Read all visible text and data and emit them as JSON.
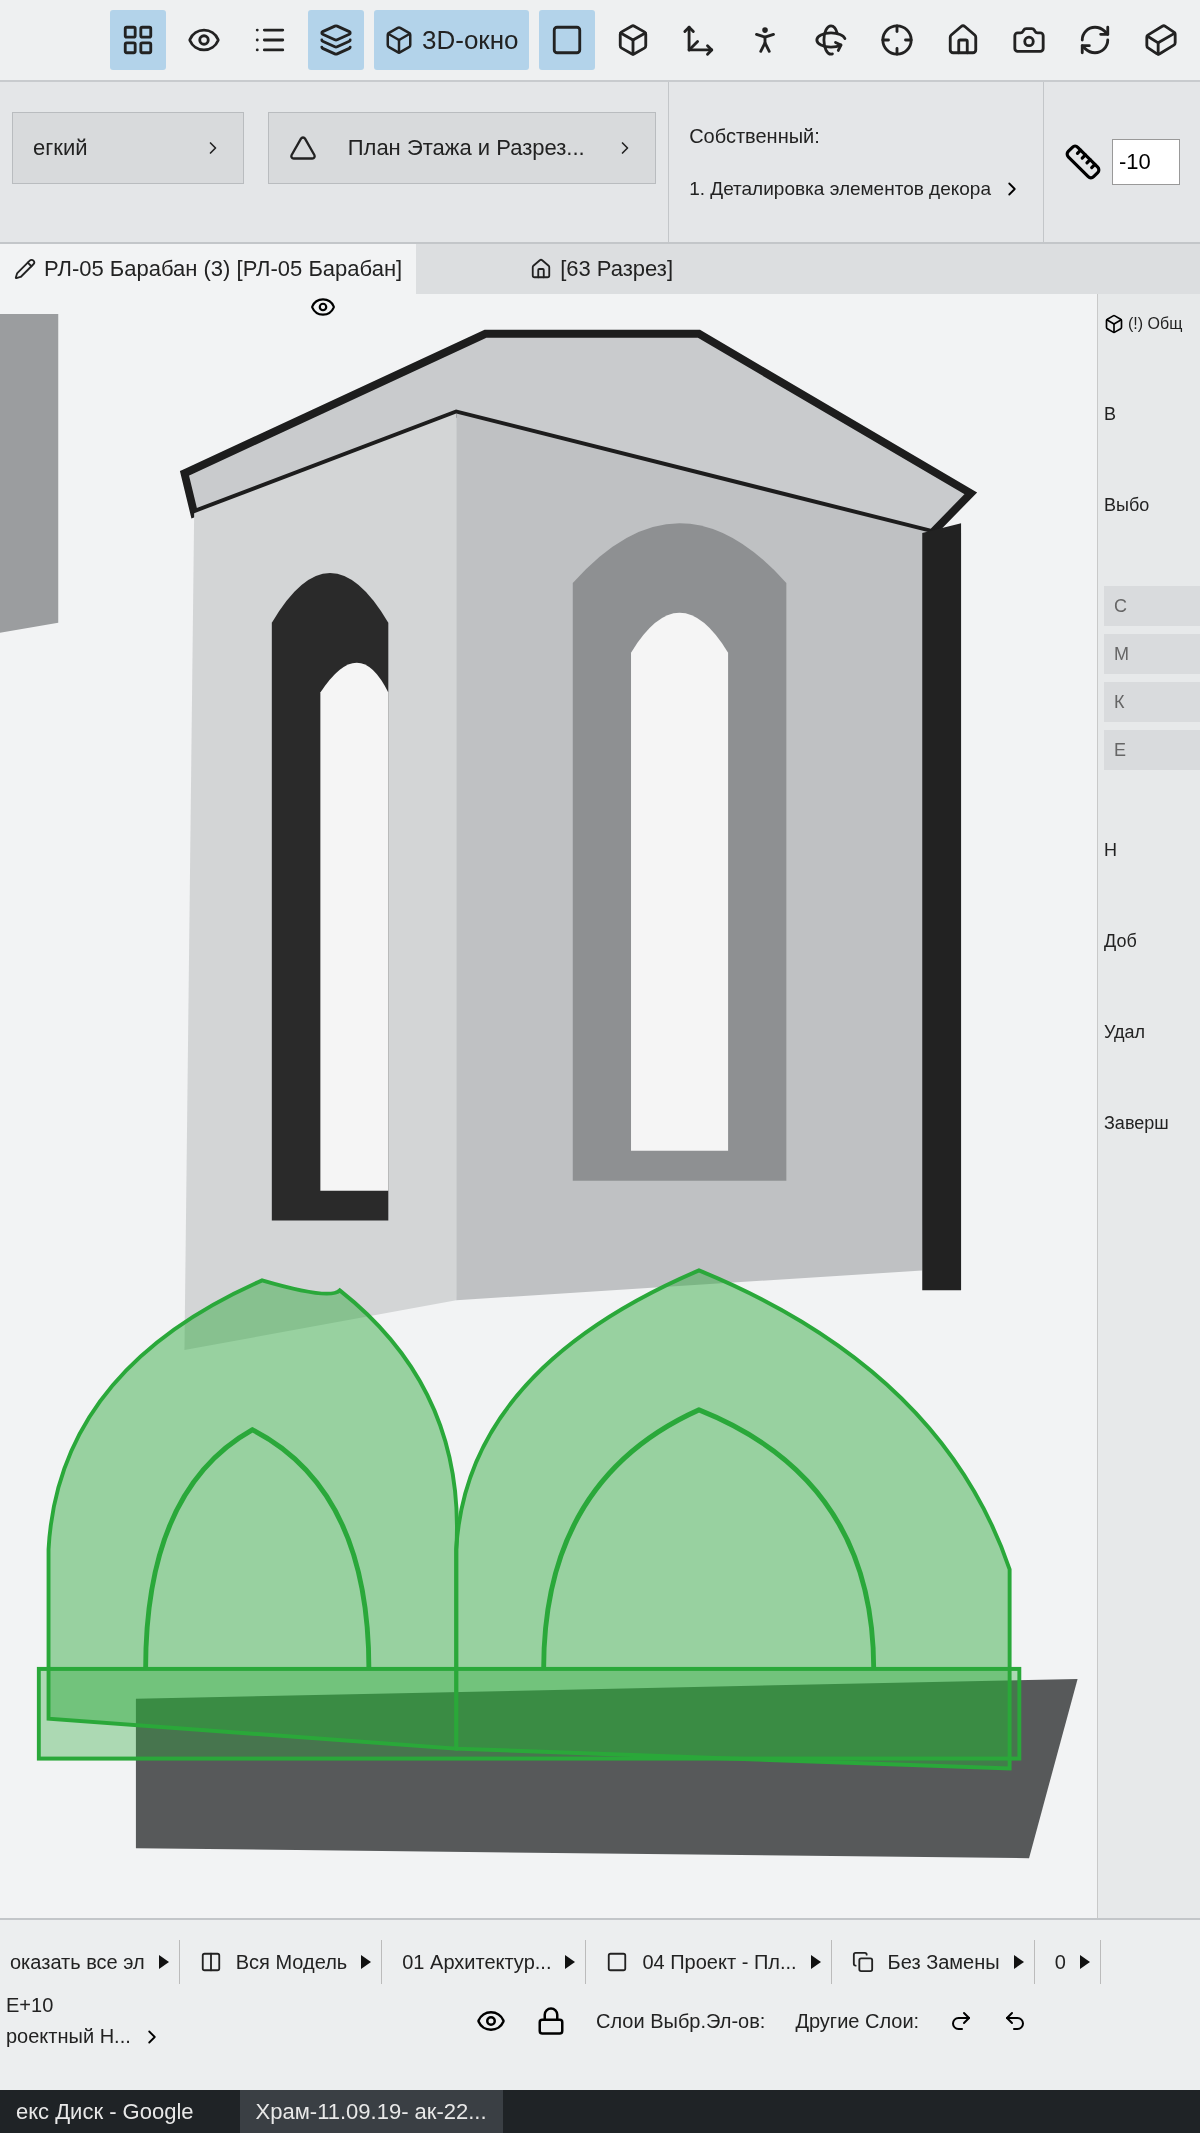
{
  "toolbar": {
    "buttons": [
      {
        "kind": "icon",
        "selected": true
      },
      {
        "kind": "icon",
        "selected": false
      },
      {
        "kind": "icon",
        "selected": false
      },
      {
        "kind": "icon",
        "selected": true
      },
      {
        "kind": "text",
        "label": "3D-окно",
        "selected": true
      },
      {
        "kind": "icon",
        "selected": true
      },
      {
        "kind": "icon",
        "selected": false
      },
      {
        "kind": "icon",
        "selected": false
      },
      {
        "kind": "icon",
        "selected": false
      },
      {
        "kind": "icon",
        "selected": false
      },
      {
        "kind": "icon",
        "selected": false
      },
      {
        "kind": "icon",
        "selected": false
      },
      {
        "kind": "icon",
        "selected": false
      },
      {
        "kind": "icon",
        "selected": false
      },
      {
        "kind": "icon",
        "selected": false
      }
    ]
  },
  "info_bar": {
    "pen_set": "егкий",
    "model_view": "План Этажа и Разрез...",
    "custom_label": "Собственный:",
    "custom_value": "1. Деталировка  элементов декора",
    "offset_value": "-10"
  },
  "tabs": [
    {
      "label": "РЛ-05 Барабан (3) [РЛ-05 Барабан]",
      "selected": true
    },
    {
      "label": "[63 Разрез]",
      "selected": false
    }
  ],
  "right_panel": {
    "tab": "(!) Общ",
    "sections": [
      "В",
      "Выбо",
      "Н",
      "Доб",
      "Удал",
      "Заверш"
    ],
    "rows": [
      "С",
      "М",
      "К",
      "Е"
    ]
  },
  "status_bar": {
    "items": [
      "оказать все эл",
      "Вся Модель",
      "01 Архитектур...",
      "04 Проект - Пл...",
      "Без Замены",
      "0"
    ],
    "scale": "Е+10",
    "mode": "роектный Н...",
    "selected_layers": "Слои Выбр.Эл-ов:",
    "other_layers": "Другие Слои:"
  },
  "taskbar": [
    {
      "label": "екс Диск - Google",
      "selected": false
    },
    {
      "label": "Храм-11.09.19- ак-22...",
      "selected": true
    }
  ]
}
